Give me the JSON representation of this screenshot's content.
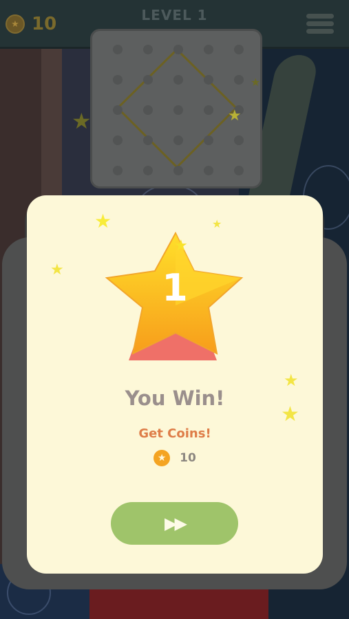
{
  "header": {
    "coin_count": "10",
    "level_title": "LEVEL 1",
    "coin_icon": "star-coin-icon",
    "menu_icon": "hamburger-menu-icon"
  },
  "board": {
    "rows": 5,
    "cols": 5,
    "shape": "diamond"
  },
  "result": {
    "stars_earned": "1",
    "title": "You Win!",
    "reward_label": "Get Coins!",
    "reward_amount": "10",
    "next_icon": "fast-forward-icon"
  },
  "colors": {
    "card_bg": "#fdf8d8",
    "next_button": "#9fc46a",
    "reward_text": "#de7d48",
    "star_top": "#ffd21f",
    "star_bottom": "#f7a21a"
  }
}
